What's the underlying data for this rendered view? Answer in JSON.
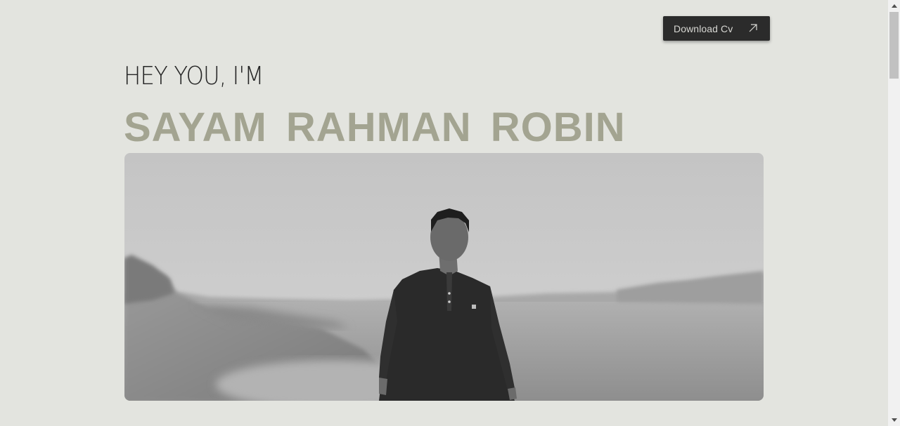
{
  "header": {
    "download_label": "Download Cv",
    "download_icon": "arrow-up-right-icon"
  },
  "hero": {
    "greeting": "HEY YOU, I'M",
    "name": "SAYAM RAHMAN ROBIN"
  },
  "photo": {
    "subject": "portrait-photo"
  },
  "colors": {
    "background": "#e3e4df",
    "button_bg": "#2b2b2b",
    "name_color": "#a3a491",
    "greeting_color": "#262626"
  }
}
